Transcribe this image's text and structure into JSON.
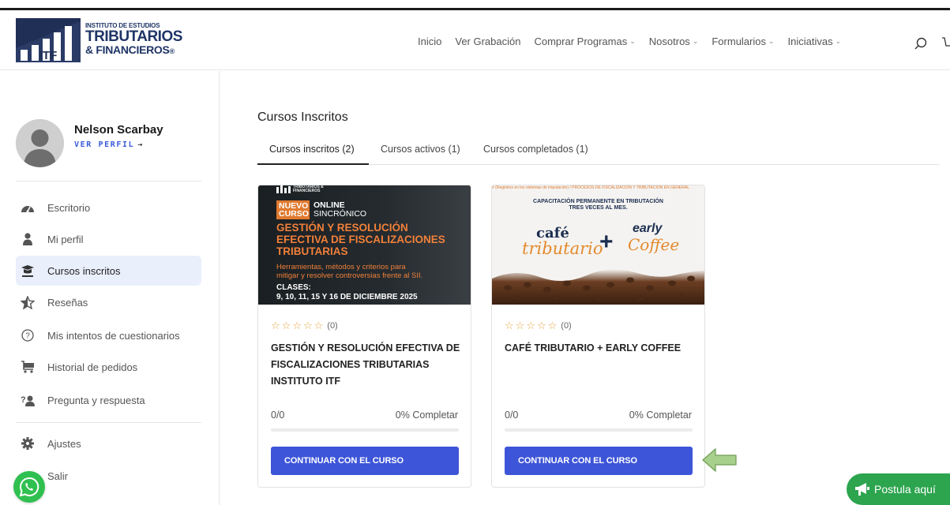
{
  "header": {
    "logo": {
      "mark_text": "ITF",
      "line1": "INSTITUTO DE ESTUDIOS",
      "line2": "TRIBUTARIOS",
      "line3": "& FINANCIEROS",
      "reg": "®"
    },
    "nav": [
      {
        "label": "Inicio",
        "dropdown": false
      },
      {
        "label": "Ver Grabación",
        "dropdown": false
      },
      {
        "label": "Comprar Programas",
        "dropdown": true
      },
      {
        "label": "Nosotros",
        "dropdown": true
      },
      {
        "label": "Formularios",
        "dropdown": true
      },
      {
        "label": "Iniciativas",
        "dropdown": true
      }
    ],
    "chevron": "⌄"
  },
  "sidebar": {
    "user_name": "Nelson Scarbay",
    "view_profile": "VER PERFIL",
    "view_profile_arrow": "→",
    "items": [
      {
        "label": "Escritorio",
        "icon": "dashboard-icon",
        "active": false
      },
      {
        "label": "Mi perfil",
        "icon": "user-icon",
        "active": false
      },
      {
        "label": "Cursos inscritos",
        "icon": "graduation-cap-icon",
        "active": true
      },
      {
        "label": "Reseñas",
        "icon": "star-icon",
        "active": false
      },
      {
        "label": "Mis intentos de cuestionarios",
        "icon": "question-circle-icon",
        "active": false
      },
      {
        "label": "Historial de pedidos",
        "icon": "cart-icon",
        "active": false
      },
      {
        "label": "Pregunta y respuesta",
        "icon": "qa-icon",
        "active": false
      },
      {
        "label": "Ajustes",
        "icon": "gear-icon",
        "active": false
      },
      {
        "label": "Salir",
        "icon": "logout-icon",
        "active": false
      }
    ]
  },
  "main": {
    "title": "Cursos Inscritos",
    "tabs": [
      {
        "label": "Cursos inscritos (2)",
        "active": true
      },
      {
        "label": "Cursos activos (1)",
        "active": false
      },
      {
        "label": "Cursos completados (1)",
        "active": false
      }
    ],
    "courses": [
      {
        "thumb": {
          "brand": "TRIBUTARIOS & FINANCIEROS",
          "nuevo": "NUEVO",
          "curso": "CURSO",
          "online": "ONLINE",
          "sincronico": "SINCRÓNICO",
          "headline": [
            "GESTIÓN Y RESOLUCIÓN",
            "EFECTIVA DE FISCALIZACIONES",
            "TRIBUTARIAS"
          ],
          "sub": [
            "Herramientas, métodos y criterios para",
            "mitigar y resolver controversias frente al SII."
          ],
          "clases_label": "CLASES:",
          "clases_dates": "9, 10, 11, 15 Y 16 DE DICIEMBRE 2025"
        },
        "rating_count": "(0)",
        "rating": 0,
        "title": "GESTIÓN Y RESOLUCIÓN EFECTIVA DE FISCALIZACIONES TRIBUTARIAS INSTITUTO ITF",
        "progress_count": "0/0",
        "progress_text": "0% Completar",
        "progress": 0,
        "button": "CONTINUAR CON EL CURSO"
      },
      {
        "thumb": {
          "ribbon": "# (Registros en los sistemas de imputación) / PROCESOS DE FISCALIZACIÓN Y TRIBUTACIÓN EN GENERAL",
          "cap1": "CAPACITACIÓN PERMANENTE EN TRIBUTACIÓN",
          "cap2": "TRES VECES AL MES.",
          "cafe": "café",
          "tributario": "tributario",
          "plus": "+",
          "early": "early",
          "coffee": "Coffee"
        },
        "rating_count": "(0)",
        "rating": 0,
        "title": "CAFÉ TRIBUTARIO + EARLY COFFEE",
        "progress_count": "0/0",
        "progress_text": "0% Completar",
        "progress": 0,
        "button": "CONTINUAR CON EL CURSO"
      }
    ]
  },
  "postula": {
    "label": "Postula aquí"
  },
  "colors": {
    "accent": "#3d55d8",
    "active_bg": "#e9effb",
    "star": "#e8a640",
    "whatsapp": "#2fc04f",
    "postula": "#2da44e",
    "arrow": "#a8d08d"
  }
}
